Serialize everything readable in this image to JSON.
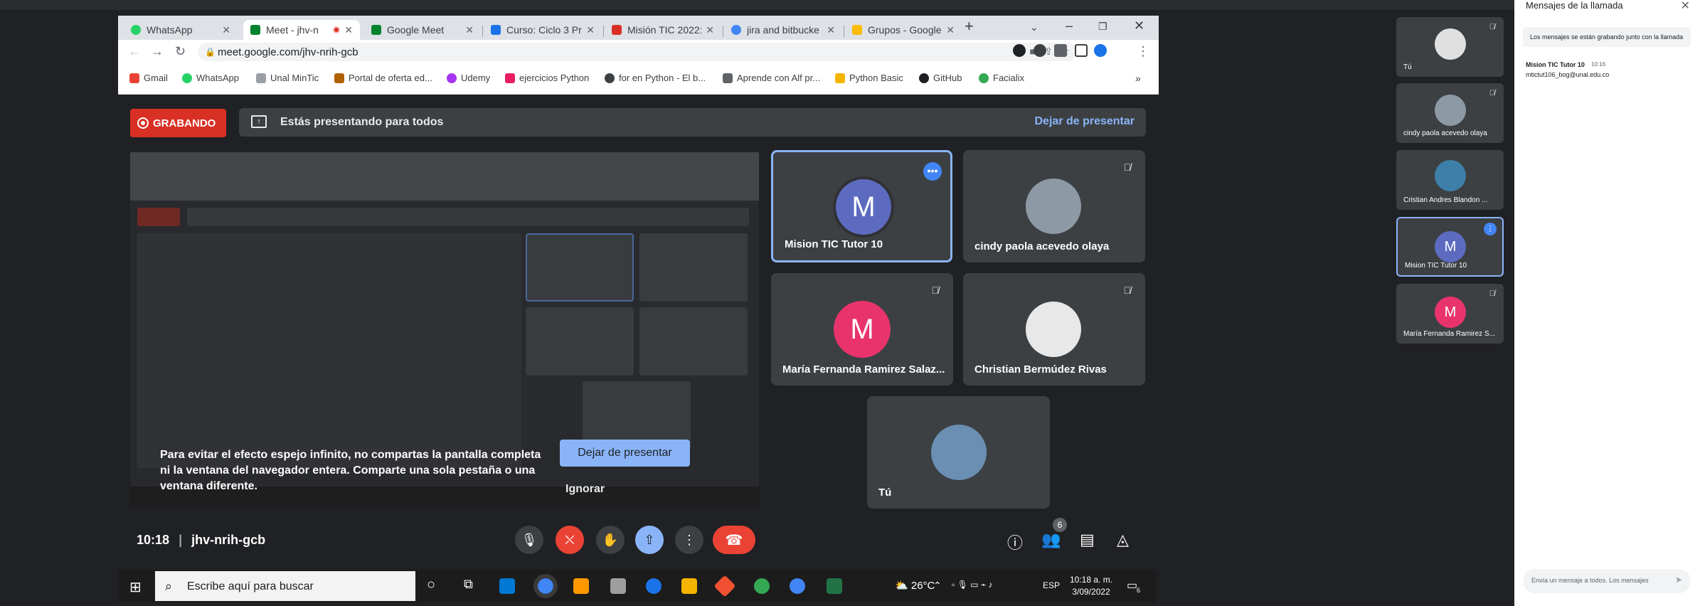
{
  "browser": {
    "tabs": [
      {
        "label": "WhatsApp",
        "color": "#25d366"
      },
      {
        "label": "Meet - jhv-n",
        "color": "#00832d"
      },
      {
        "label": "Google Meet",
        "color": "#00832d"
      },
      {
        "label": "Curso: Ciclo 3 Pr",
        "color": "#1a73e8"
      },
      {
        "label": "Misión TIC 2022:",
        "color": "#d93025"
      },
      {
        "label": "jira and bitbucke",
        "color": "#4285f4"
      },
      {
        "label": "Grupos - Google",
        "color": "#fbbc04"
      }
    ],
    "new_tab": "+",
    "url": "meet.google.com/jhv-nrih-gcb",
    "bookmarks": [
      {
        "label": "Gmail",
        "color": "#ea4335"
      },
      {
        "label": "WhatsApp",
        "color": "#25d366"
      },
      {
        "label": "Unal MinTic",
        "color": "#9aa0a6"
      },
      {
        "label": "Portal de oferta ed...",
        "color": "#b06000"
      },
      {
        "label": "Udemy",
        "color": "#a435f0"
      },
      {
        "label": "ejercicios Python",
        "color": "#e91e63"
      },
      {
        "label": "for en Python - El b...",
        "color": "#3c4043"
      },
      {
        "label": "Aprende con Alf pr...",
        "color": "#5f6368"
      },
      {
        "label": "Python Basic",
        "color": "#f4b400"
      },
      {
        "label": "GitHub",
        "color": "#202124"
      },
      {
        "label": "Facialix",
        "color": "#34a853"
      }
    ]
  },
  "meet": {
    "recording_label": "GRABANDO",
    "presenting_text": "Estás presentando para todos",
    "stop_presenting": "Dejar de presentar",
    "warning": "Para evitar el efecto espejo infinito, no compartas la pantalla completa ni la ventana del navegador entera. Comparte una sola pestaña o una ventana diferente.",
    "stop_button": "Dejar de presentar",
    "ignore": "Ignorar",
    "time": "10:18",
    "meeting_code": "jhv-nrih-gcb",
    "participants_count": "6",
    "tiles": [
      {
        "name": "Mision TIC Tutor 10",
        "initial": "M",
        "color": "#5c6bc0",
        "kind": "initial"
      },
      {
        "name": "cindy paola acevedo olaya",
        "initial": "",
        "color": "#8d9aa6",
        "kind": "photo"
      },
      {
        "name": "María Fernanda Ramirez Salaz...",
        "initial": "M",
        "color": "#e8336d",
        "kind": "initial"
      },
      {
        "name": "Christian Bermúdez Rivas",
        "initial": "",
        "color": "#e8e8e8",
        "kind": "photo"
      },
      {
        "name": "Tú",
        "initial": "",
        "color": "#6b8fb3",
        "kind": "photo"
      }
    ]
  },
  "side_tiles": [
    {
      "name": "Tú",
      "initial": "",
      "color": "#e0e0e0"
    },
    {
      "name": "cindy paola acevedo olaya",
      "initial": "",
      "color": "#8d9aa6"
    },
    {
      "name": "Cristian Andres Blandon ...",
      "initial": "",
      "color": "#3d7fa8"
    },
    {
      "name": "Mision TIC Tutor 10",
      "initial": "M",
      "color": "#5c6bc0"
    },
    {
      "name": "María Fernanda Ramirez S...",
      "initial": "M",
      "color": "#e8336d"
    }
  ],
  "chat": {
    "title": "Mensajes de la llamada",
    "note": "Los mensajes se están grabando junto con la llamada",
    "sender": "Mision TIC Tutor 10",
    "msg_time": "10:16",
    "message": "mtictut106_bog@unal.edu.co",
    "placeholder": "Envía un mensaje a todos. Los mensajes"
  },
  "taskbar": {
    "search_placeholder": "Escribe aquí para buscar",
    "temperature": "26°C",
    "lang": "ESP",
    "clock_time": "10:18 a. m.",
    "clock_date": "3/09/2022",
    "notif_count": "6"
  }
}
